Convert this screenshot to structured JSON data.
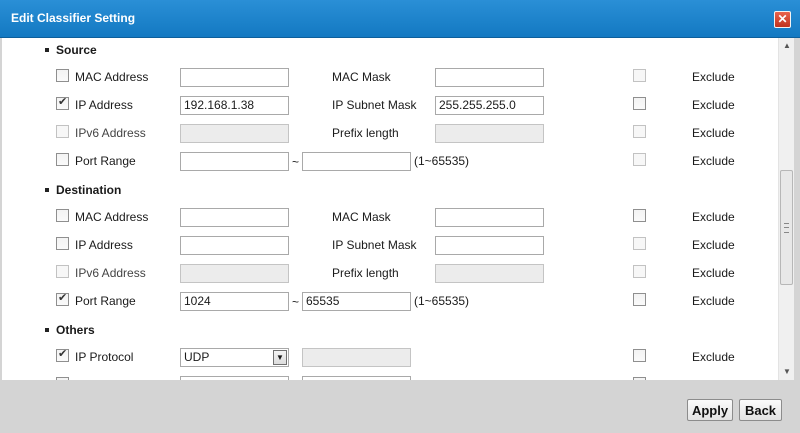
{
  "dialog": {
    "title": "Edit Classifier Setting",
    "close_glyph": "✕"
  },
  "source": {
    "heading": "Source",
    "mac": {
      "label": "MAC Address",
      "value": "",
      "mask_label": "MAC Mask",
      "mask_value": "",
      "checked": false,
      "exclude": false
    },
    "ip": {
      "label": "IP Address",
      "value": "192.168.1.38",
      "mask_label": "IP Subnet Mask",
      "mask_value": "255.255.255.0",
      "checked": true,
      "exclude": false
    },
    "ipv6": {
      "label": "IPv6 Address",
      "value": "",
      "mask_label": "Prefix length",
      "mask_value": "",
      "checked": false,
      "exclude": false
    },
    "port": {
      "label": "Port Range",
      "from": "",
      "to": "",
      "range_hint": "(1~65535)",
      "checked": false,
      "exclude": false
    }
  },
  "destination": {
    "heading": "Destination",
    "mac": {
      "label": "MAC Address",
      "value": "",
      "mask_label": "MAC Mask",
      "mask_value": "",
      "checked": false,
      "exclude": false
    },
    "ip": {
      "label": "IP Address",
      "value": "",
      "mask_label": "IP Subnet Mask",
      "mask_value": "",
      "checked": false,
      "exclude": false
    },
    "ipv6": {
      "label": "IPv6 Address",
      "value": "",
      "mask_label": "Prefix length",
      "mask_value": "",
      "checked": false,
      "exclude": false
    },
    "port": {
      "label": "Port Range",
      "from": "1024",
      "to": "65535",
      "range_hint": "(1~65535)",
      "checked": true,
      "exclude": false
    }
  },
  "others": {
    "heading": "Others",
    "protocol": {
      "label": "IP Protocol",
      "selected": "UDP",
      "extra_value": "",
      "checked": true,
      "exclude": false
    }
  },
  "exclude_label": "Exclude",
  "tilde": "~",
  "buttons": {
    "apply": "Apply",
    "back": "Back"
  }
}
